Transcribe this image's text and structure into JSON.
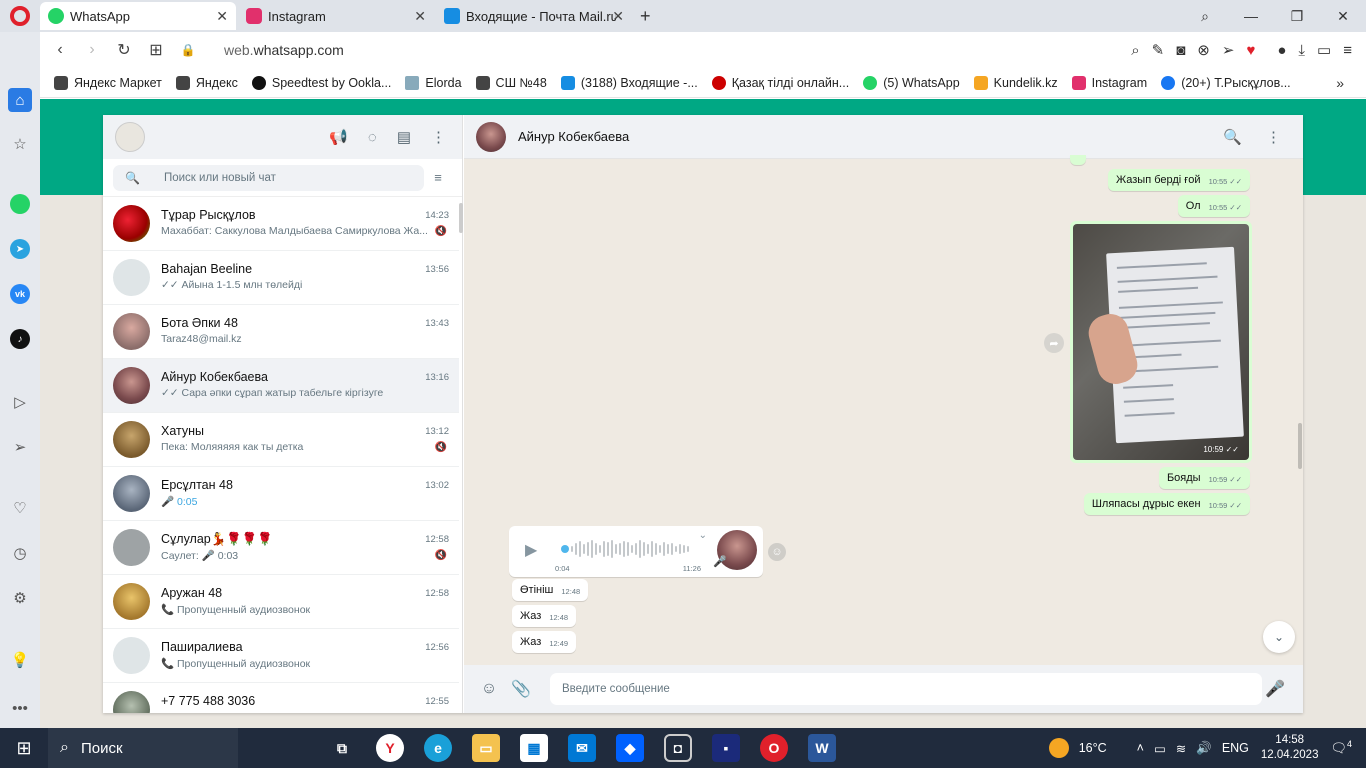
{
  "tabs": [
    {
      "label": "WhatsApp",
      "color": "#25d366"
    },
    {
      "label": "Instagram",
      "color": "#e1306c"
    },
    {
      "label": "Входящие - Почта Mail.ru",
      "color": "#168de2"
    }
  ],
  "address": {
    "host": "web.",
    "domain": "whatsapp.com"
  },
  "bookmarks": [
    {
      "label": "Яндекс Маркет",
      "color": "#444"
    },
    {
      "label": "Яндекс",
      "color": "#444"
    },
    {
      "label": "Speedtest by Ookla...",
      "color": "#111"
    },
    {
      "label": "Elorda",
      "color": "#4a7"
    },
    {
      "label": "СШ №48",
      "color": "#444"
    },
    {
      "label": "(3188) Входящие -...",
      "color": "#168de2"
    },
    {
      "label": "Қазақ тілді онлайн...",
      "color": "#c00"
    },
    {
      "label": "(5) WhatsApp",
      "color": "#25d366"
    },
    {
      "label": "Kundelik.kz",
      "color": "#f5a623"
    },
    {
      "label": "Instagram",
      "color": "#e1306c"
    },
    {
      "label": "(20+) Т.Рысқұлов...",
      "color": "#1877f2"
    }
  ],
  "left": {
    "search_placeholder": "Поиск или новый чат"
  },
  "chats": [
    {
      "name": "Тұрар Рысқұлов",
      "time": "14:23",
      "preview": "Махаббат: Саккулова  Малдыбаева  Самиркулова  Жа...",
      "muted": true,
      "color": "#b22222"
    },
    {
      "name": "Bahajan Beeline",
      "time": "13:56",
      "preview": "✓✓ Айына 1-1.5 млн төлейді",
      "muted": false,
      "color": "#dfe5e7"
    },
    {
      "name": "Бота Әпки 48",
      "time": "13:43",
      "preview": "Taraz48@mail.kz",
      "muted": false,
      "color": "#a97c6e"
    },
    {
      "name": "Айнур Кобекбаева",
      "time": "13:16",
      "preview": "✓✓ Сара әпки сұрап жатыр табельге кіргізуге",
      "muted": false,
      "color": "#8b4a4f"
    },
    {
      "name": "Хатуны",
      "time": "13:12",
      "preview": "Пека: Моляяяяя как ты детка",
      "muted": true,
      "color": "#9c7b4a"
    },
    {
      "name": "Ерсұлтан 48",
      "time": "13:02",
      "preview": "🎤 0:05",
      "muted": false,
      "color": "#7a8797"
    },
    {
      "name": "Сұлулар💃🌹🌹🌹",
      "time": "12:58",
      "preview": "Саулет: 🎤 0:03",
      "muted": true,
      "color": "#9ea3a5"
    },
    {
      "name": "Аружан 48",
      "time": "12:58",
      "preview": "📞 Пропущенный аудиозвонок",
      "muted": false,
      "color": "#c2a14d"
    },
    {
      "name": "Паширалиева",
      "time": "12:56",
      "preview": "📞 Пропущенный аудиозвонок",
      "muted": false,
      "color": "#dfe5e7"
    },
    {
      "name": "+7 775 488 3036",
      "time": "12:55",
      "preview": "",
      "muted": false,
      "color": "#7c8a7a"
    }
  ],
  "conversation": {
    "contact": "Айнур Кобекбаева",
    "messages": {
      "m1": {
        "text": "Жазып берді ғой",
        "time": "10:55"
      },
      "m2": {
        "text": "Ол",
        "time": "10:55"
      },
      "photo_time": "10:59",
      "m3": {
        "text": "Бояды",
        "time": "10:59"
      },
      "m4": {
        "text": "Шляпасы дұрыс екен",
        "time": "10:59"
      },
      "voice": {
        "duration": "0:04",
        "time": "11:26"
      },
      "m5": {
        "text": "Өтініш",
        "time": "12:48"
      },
      "m6": {
        "text": "Жаз",
        "time": "12:48"
      },
      "m7": {
        "text": "Жаз",
        "time": "12:49"
      }
    },
    "input_placeholder": "Введите сообщение"
  },
  "taskbar": {
    "search": "Поиск",
    "temperature": "16°C",
    "lang": "ENG",
    "time": "14:58",
    "date": "12.04.2023",
    "notifications": "4"
  }
}
